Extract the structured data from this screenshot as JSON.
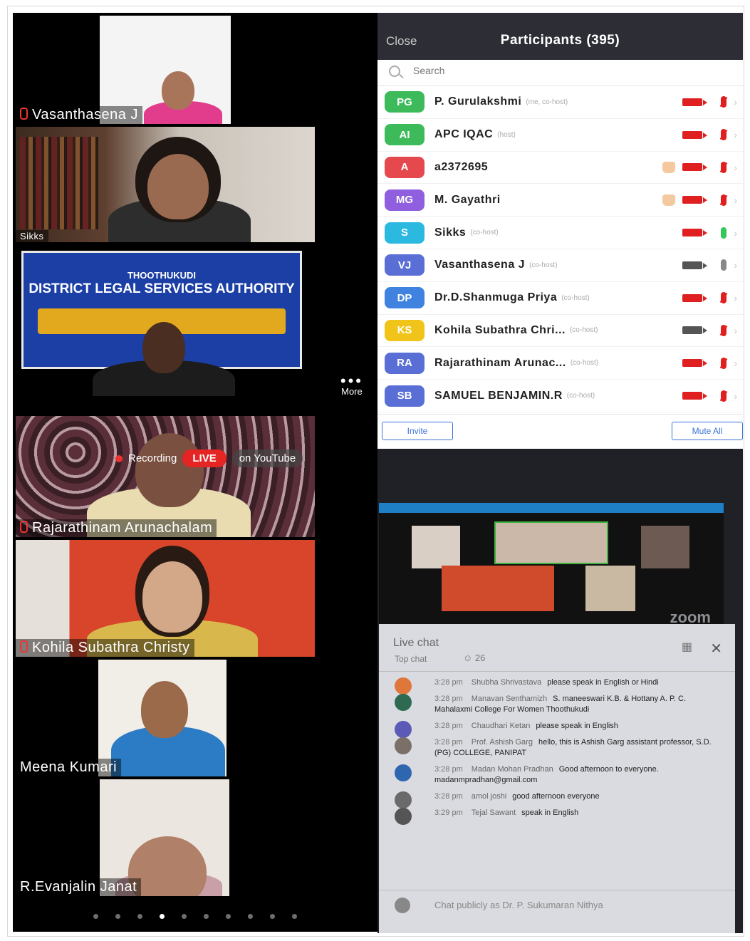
{
  "left_tiles": {
    "tile1_name": "Vasanthasena J",
    "tile2_name": "Sikks",
    "banner_line1": "THOOTHUKUDI",
    "banner_line2": "DISTRICT LEGAL SERVICES AUTHORITY",
    "more_label": "More",
    "tile4_name": "Rajarathinam Arunachalam",
    "recording_label": "Recording",
    "live_badge": "LIVE",
    "youtube_label": "on YouTube",
    "tile5_name": "Kohila Subathra Christy",
    "tile6_name": "Meena Kumari",
    "tile7_name": "R.Evanjalin Janat",
    "pager_count": 10,
    "pager_active": 4
  },
  "participants": {
    "close_label": "Close",
    "title": "Participants (395)",
    "search_placeholder": "Search",
    "invite_label": "Invite",
    "mute_all_label": "Mute All",
    "rows": [
      {
        "initials": "PG",
        "name": "P. Gurulakshmi",
        "tag": "(me, co-host)",
        "color": "#3dbb5a",
        "hand": false,
        "video": "off",
        "mic": "off"
      },
      {
        "initials": "AI",
        "name": "APC IQAC",
        "tag": "(host)",
        "color": "#3dbb5a",
        "hand": false,
        "video": "off",
        "mic": "off"
      },
      {
        "initials": "A",
        "name": "a2372695",
        "tag": "",
        "color": "#e5484d",
        "hand": true,
        "video": "off",
        "mic": "off"
      },
      {
        "initials": "MG",
        "name": "M. Gayathri",
        "tag": "",
        "color": "#8f5fe0",
        "hand": true,
        "video": "off",
        "mic": "off"
      },
      {
        "initials": "S",
        "name": "Sikks",
        "tag": "(co-host)",
        "color": "#2cb9e0",
        "hand": false,
        "video": "off",
        "mic": "on"
      },
      {
        "initials": "VJ",
        "name": "Vasanthasena J",
        "tag": "(co-host)",
        "color": "#5a6fd6",
        "hand": false,
        "video": "on",
        "mic": "gray"
      },
      {
        "initials": "DP",
        "name": "Dr.D.Shanmuga Priya",
        "tag": "(co-host)",
        "color": "#3f82e0",
        "hand": false,
        "video": "off",
        "mic": "off"
      },
      {
        "initials": "KS",
        "name": "Kohila Subathra Chri...",
        "tag": "(co-host)",
        "color": "#f0c419",
        "hand": false,
        "video": "on",
        "mic": "off"
      },
      {
        "initials": "RA",
        "name": "Rajarathinam Arunac...",
        "tag": "(co-host)",
        "color": "#5a6fd6",
        "hand": false,
        "video": "off",
        "mic": "off"
      },
      {
        "initials": "SB",
        "name": "SAMUEL BENJAMIN.R",
        "tag": "(co-host)",
        "color": "#5a6fd6",
        "hand": false,
        "video": "off",
        "mic": "off"
      }
    ]
  },
  "live_chat": {
    "zoom_label": "zoom",
    "title": "Live chat",
    "sub": "Top chat",
    "viewers": "26",
    "messages": [
      {
        "time": "3:28 pm",
        "author": "Shubha Shrivastava",
        "text": "please speak in English or Hindi",
        "avatar": "#e0773a"
      },
      {
        "time": "3:28 pm",
        "author": "Manavan Senthamizh",
        "text": "S. maneeswari K.B. & Hottany A. P. C. Mahalaxmi College For Women Thoothukudi",
        "avatar": "#2e6a52"
      },
      {
        "time": "3:28 pm",
        "author": "Chaudhari Ketan",
        "text": "please speak in English",
        "avatar": "#5b5ab6"
      },
      {
        "time": "3:28 pm",
        "author": "Prof. Ashish Garg",
        "text": "hello, this is Ashish Garg assistant professor, S.D.(PG) COLLEGE, PANIPAT",
        "avatar": "#7a7068"
      },
      {
        "time": "3:28 pm",
        "author": "Madan Mohan Pradhan",
        "text": "Good afternoon to everyone. madanmpradhan@gmail.com",
        "avatar": "#2f66b0"
      },
      {
        "time": "3:28 pm",
        "author": "amol joshi",
        "text": "good afternoon everyone",
        "avatar": "#6a6a6a"
      },
      {
        "time": "3:29 pm",
        "author": "Tejal Sawant",
        "text": "speak in English",
        "avatar": "#555"
      }
    ],
    "input_placeholder": "Chat publicly as Dr. P. Sukumaran Nithya"
  }
}
